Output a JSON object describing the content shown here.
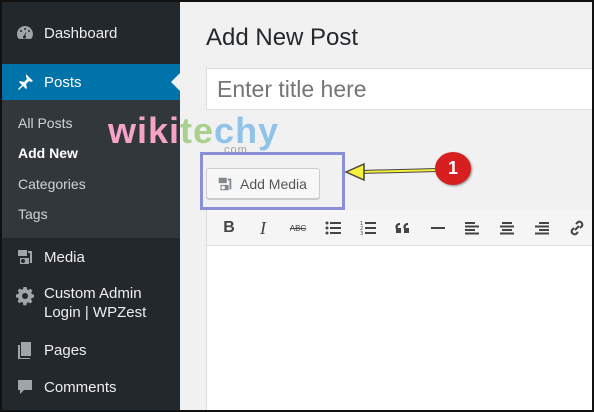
{
  "sidebar": {
    "items": [
      {
        "label": "Dashboard",
        "icon": "dashboard-icon"
      },
      {
        "label": "Posts",
        "icon": "pin-icon",
        "active": true
      },
      {
        "label": "Media",
        "icon": "media-icon"
      },
      {
        "label_line1": "Custom Admin",
        "label_line2": "Login | WPZest",
        "icon": "gear-icon"
      },
      {
        "label": "Pages",
        "icon": "pages-icon"
      },
      {
        "label": "Comments",
        "icon": "comment-icon"
      }
    ],
    "submenu": [
      "All Posts",
      "Add New",
      "Categories",
      "Tags"
    ],
    "colors": {
      "bg": "#23282d",
      "active": "#0073aa",
      "submenu_bg": "#32373c"
    }
  },
  "main": {
    "title": "Add New Post",
    "title_placeholder": "Enter title here",
    "add_media_label": "Add Media",
    "callout_number": "1",
    "toolbar": [
      "bold",
      "italic",
      "strikethrough",
      "bullet-list",
      "numbered-list",
      "blockquote",
      "horizontal-line",
      "align-left",
      "align-center",
      "align-right",
      "link"
    ],
    "toolbar_labels": {
      "bold": "B",
      "italic": "I",
      "strike": "ABC"
    }
  },
  "watermark": {
    "text_a": "wiki",
    "text_b": "te",
    "text_c": "chy",
    "suffix": ".com"
  }
}
